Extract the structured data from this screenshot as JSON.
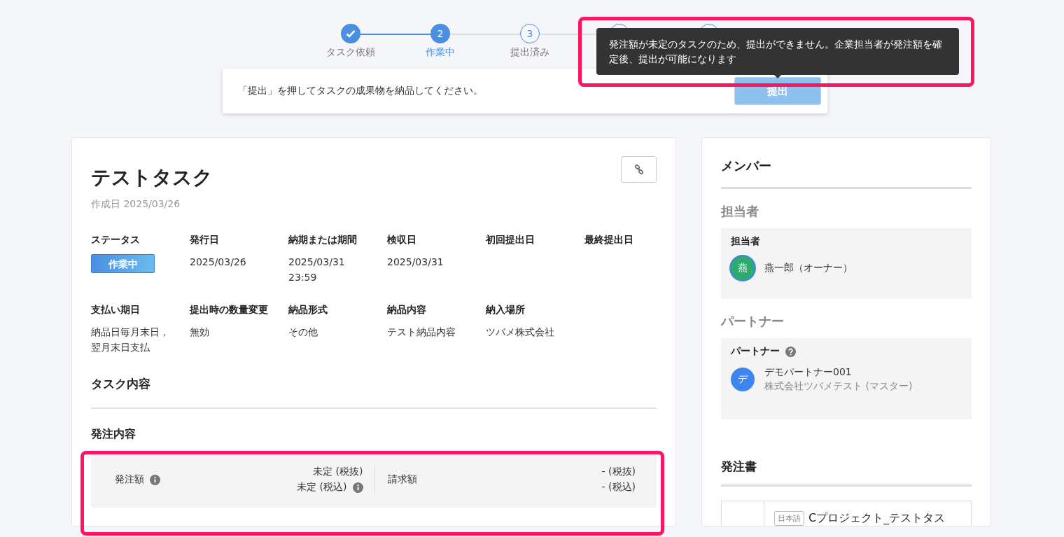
{
  "stepper": [
    {
      "label": "タスク依頼",
      "done": true,
      "current": false
    },
    {
      "number": "2",
      "label": "作業中",
      "done": false,
      "current": true
    },
    {
      "number": "3",
      "label": "提出済み",
      "done": false,
      "current": false
    },
    {
      "done": false,
      "current": false
    },
    {
      "done": false,
      "current": false
    }
  ],
  "tooltip": {
    "text": "発注額が未定のタスクのため、提出ができません。企業担当者が発注額を確定後、提出が可能になります"
  },
  "instruction": {
    "text": "「提出」を押してタスクの成果物を納品してください。",
    "button": {
      "label": "提出",
      "disabled": true
    }
  },
  "task": {
    "title": "テストタスク",
    "created": "作成日 2025/03/26",
    "fields": [
      {
        "label": "ステータス",
        "kind": "badge",
        "value": "作業中"
      },
      {
        "label": "発行日",
        "kind": "text",
        "value": "2025/03/26"
      },
      {
        "label": "納期または期間",
        "kind": "text",
        "value": "2025/03/31 23:59"
      },
      {
        "label": "検収日",
        "kind": "text",
        "value": "2025/03/31"
      },
      {
        "label": "初回提出日",
        "kind": "text"
      },
      {
        "label": "最終提出日",
        "kind": "text"
      },
      {
        "label": "支払い期日",
        "kind": "text",
        "value": "納品日毎月末日，翌月末日支払"
      },
      {
        "label": "提出時の数量変更",
        "kind": "text",
        "value": "無効"
      },
      {
        "label": "納品形式",
        "kind": "text",
        "value": "その他"
      },
      {
        "label": "納品内容",
        "kind": "text",
        "value": "テスト納品内容"
      },
      {
        "label": "納入場所",
        "kind": "text",
        "value": "ツバメ株式会社"
      }
    ],
    "content_heading": "タスク内容",
    "order": {
      "heading": "発注内容",
      "amount_label": "発注額",
      "amount_excl": "未定 (税抜)",
      "amount_incl": "未定 (税込)",
      "billing_label": "請求額",
      "billing_excl": "- (税抜)",
      "billing_incl": "- (税込)"
    }
  },
  "members": {
    "heading": "メンバー",
    "sections": [
      {
        "heading": "担当者",
        "box_title": "担当者",
        "help": false,
        "person": {
          "initial": "燕",
          "name": "燕一郎（オーナー）",
          "color": "#2eaa6e",
          "ring": true
        }
      },
      {
        "heading": "パートナー",
        "box_title": "パートナー",
        "help": true,
        "person": {
          "initial": "デ",
          "name": "デモパートナー001",
          "company": "株式会社ツバメテスト (マスター)",
          "color": "#3d86f0",
          "ring": false
        }
      }
    ]
  },
  "purchase_order": {
    "heading": "発注書",
    "files": [
      {
        "language": "日本語",
        "name": "Cプロジェクト_テストタス"
      }
    ]
  }
}
